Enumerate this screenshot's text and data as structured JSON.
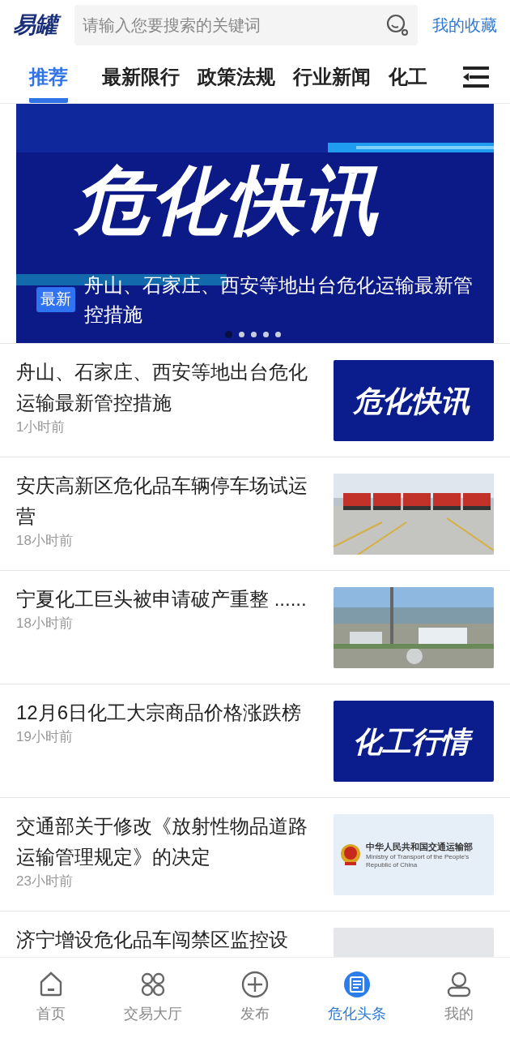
{
  "header": {
    "logo": "易罐",
    "search": {
      "placeholder": "请输入您要搜索的关键词"
    },
    "favorites_link": "我的收藏"
  },
  "tabs": [
    {
      "label": "推荐",
      "selected": true
    },
    {
      "label": "最新限行",
      "selected": false
    },
    {
      "label": "政策法规",
      "selected": false
    },
    {
      "label": "行业新闻",
      "selected": false
    },
    {
      "label": "化工",
      "selected": false
    }
  ],
  "banner": {
    "headline": "危化快讯",
    "badge": "最新",
    "caption": "舟山、石家庄、西安等地出台危化运输最新管控措施",
    "dots": [
      {
        "selected": true
      },
      {
        "selected": false
      },
      {
        "selected": false
      },
      {
        "selected": false
      },
      {
        "selected": false
      }
    ]
  },
  "articles": [
    {
      "title": "舟山、石家庄、西安等地出台危化运输最新管控措施",
      "time": "1小时前",
      "thumbnail": {
        "kind": "graphic",
        "text": "危化快讯"
      }
    },
    {
      "title": "安庆高新区危化品车辆停车场试运营",
      "time": "18小时前"
    },
    {
      "title": "宁夏化工巨头被申请破产重整 ......",
      "time": "18小时前"
    },
    {
      "title": "12月6日化工大宗商品价格涨跌榜",
      "time": "19小时前",
      "thumbnail": {
        "kind": "graphic",
        "text": "化工行情"
      }
    },
    {
      "title": "交通部关于修改《放射性物品道路运输管理规定》的决定",
      "time": "23小时前",
      "thumbnail": {
        "kind": "logo",
        "title": "中华人民共和国交通运输部",
        "subtitle": "Ministry of Transport of the People's Republic of China"
      }
    },
    {
      "title": "济宁增设危化品车闯禁区监控设",
      "thumbnail": {
        "kind": "plain"
      }
    }
  ],
  "bottom_nav": [
    {
      "label": "首页",
      "selected": false
    },
    {
      "label": "交易大厅",
      "selected": false
    },
    {
      "label": "发布",
      "selected": false
    },
    {
      "label": "危化头条",
      "selected": true
    },
    {
      "label": "我的",
      "selected": false
    }
  ]
}
